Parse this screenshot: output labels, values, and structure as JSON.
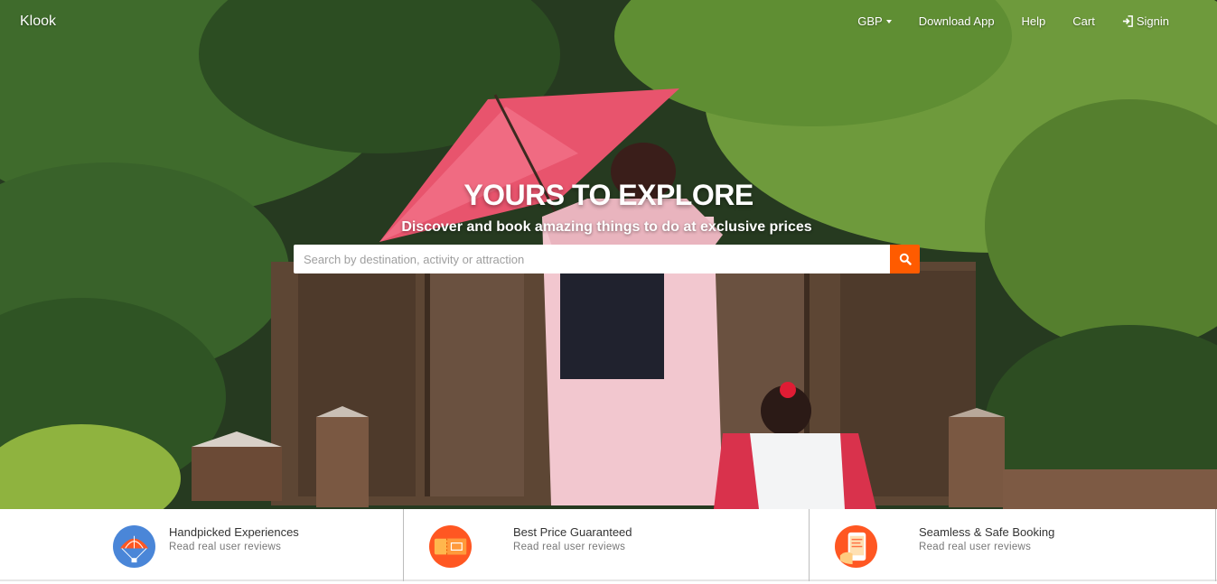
{
  "navbar": {
    "brand": "Klook",
    "currency": "GBP",
    "download_app": "Download App",
    "help": "Help",
    "cart": "Cart",
    "signin": "Signin"
  },
  "hero": {
    "title": "YOURS TO EXPLORE",
    "subtitle": "Discover and book amazing things to do at exclusive prices"
  },
  "search": {
    "placeholder": "Search by destination, activity or attraction",
    "value": "",
    "button_icon": "search-icon"
  },
  "features": [
    {
      "title": "Handpicked Experiences",
      "subtitle": "Read real user reviews",
      "icon": "parachute-icon"
    },
    {
      "title": "Best Price Guaranteed",
      "subtitle": "Read real user reviews",
      "icon": "ticket-icon"
    },
    {
      "title": "Seamless & Safe Booking",
      "subtitle": "Read real user reviews",
      "icon": "phone-booking-icon"
    }
  ],
  "colors": {
    "accent": "#ff5b00",
    "icon_blue": "#4a86d8",
    "icon_orange": "#ff5722"
  }
}
